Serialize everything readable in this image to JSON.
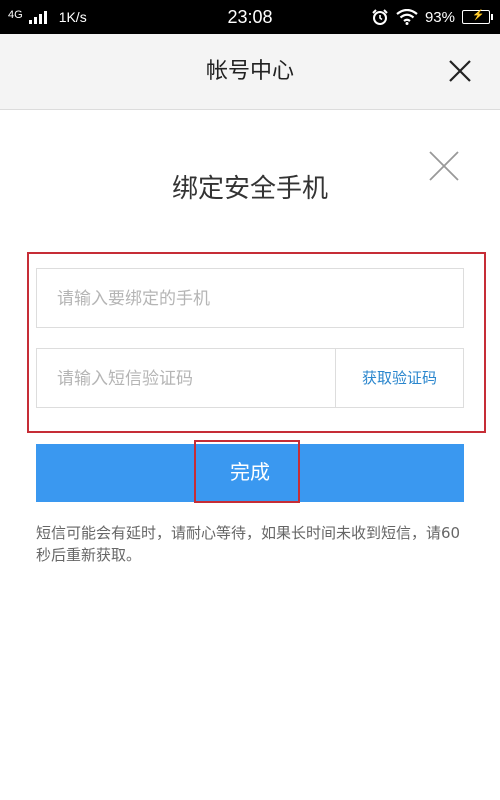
{
  "status_bar": {
    "network": "4G",
    "speed": "1K/s",
    "time": "23:08",
    "battery": "93%",
    "icons": [
      "alarm-icon",
      "wifi-icon",
      "battery-icon"
    ]
  },
  "nav": {
    "title": "帐号中心",
    "close_icon": "close-icon"
  },
  "dialog": {
    "title": "绑定安全手机",
    "close_icon": "close-icon",
    "phone_placeholder": "请输入要绑定的手机",
    "phone_value": "",
    "code_placeholder": "请输入短信验证码",
    "code_value": "",
    "get_code_label": "获取验证码",
    "done_label": "完成",
    "notice": "短信可能会有延时，请耐心等待，如果长时间未收到短信，请60秒后重新获取。"
  },
  "colors": {
    "primary": "#3a98f0",
    "link": "#2a86cd",
    "highlight": "#c62d36",
    "battery": "#7bd13a"
  }
}
